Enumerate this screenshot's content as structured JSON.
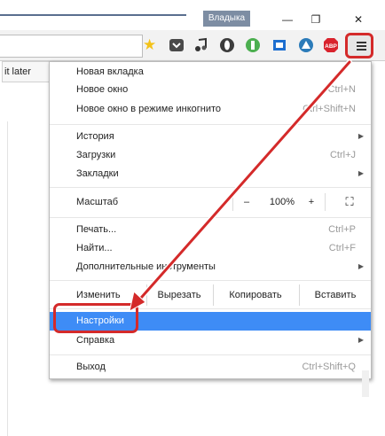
{
  "titlebar": {
    "profile_name": "Владыка",
    "minimize_glyph": "—",
    "restore_glyph": "❐",
    "close_glyph": "✕"
  },
  "page": {
    "partial_button_label": "it later"
  },
  "menu": {
    "new_tab": "Новая вкладка",
    "new_window": "Новое окно",
    "new_window_shortcut": "Ctrl+N",
    "incognito": "Новое окно в режиме инкогнито",
    "incognito_shortcut": "Ctrl+Shift+N",
    "history": "История",
    "downloads": "Загрузки",
    "downloads_shortcut": "Ctrl+J",
    "bookmarks": "Закладки",
    "zoom_label": "Масштаб",
    "zoom_minus": "–",
    "zoom_value": "100%",
    "zoom_plus": "+",
    "fullscreen_glyph": "⛶",
    "print": "Печать...",
    "print_shortcut": "Ctrl+P",
    "find": "Найти...",
    "find_shortcut": "Ctrl+F",
    "more_tools": "Дополнительные инструменты",
    "edit_label": "Изменить",
    "cut": "Вырезать",
    "copy": "Копировать",
    "paste": "Вставить",
    "settings": "Настройки",
    "help": "Справка",
    "exit": "Выход",
    "exit_shortcut": "Ctrl+Shift+Q",
    "submenu_arrow": "▶"
  },
  "colors": {
    "accent_red": "#d42a2a",
    "selection_blue": "#3e8cf6"
  }
}
